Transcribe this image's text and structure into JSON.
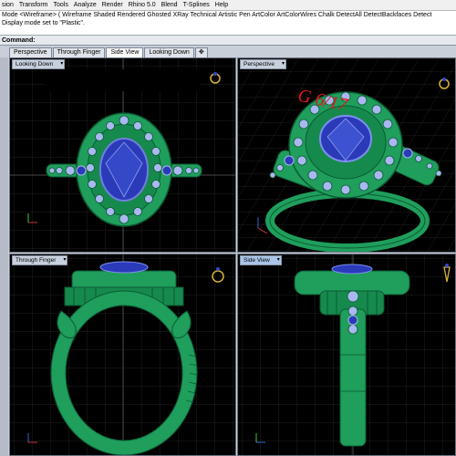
{
  "menu": [
    "sion",
    "Transform",
    "Tools",
    "Analyze",
    "Render",
    "Rhino 5.0",
    "Blend",
    "T-Splines",
    "Help"
  ],
  "command_history": {
    "line1": "Mode <Wireframe> ( Wireframe  Shaded  Rendered  Ghosted  XRay  Technical  Artistic  Pen  ArtColor  ArtColorWires  Chalk  DetectAll  DetectBackfaces  Detect",
    "line2": "Display mode set to \"Plastic\"."
  },
  "command_prompt": "Command:",
  "viewport_tabs": [
    "Perspective",
    "Through Finger",
    "Side View",
    "Looking Down"
  ],
  "viewports": {
    "top_left": "Looking Down",
    "top_right": "Perspective",
    "bottom_left": "Through Finger",
    "bottom_right": "Side View"
  },
  "overlay_text": "G           6/17",
  "colors": {
    "metal": "#1f9e5c",
    "metal_dark": "#0b5a33",
    "gem": "#2a3ab8",
    "accent_gem": "#a9b8f0",
    "grid": "#2c2c2c",
    "grid_axis": "#5a5a5a"
  }
}
